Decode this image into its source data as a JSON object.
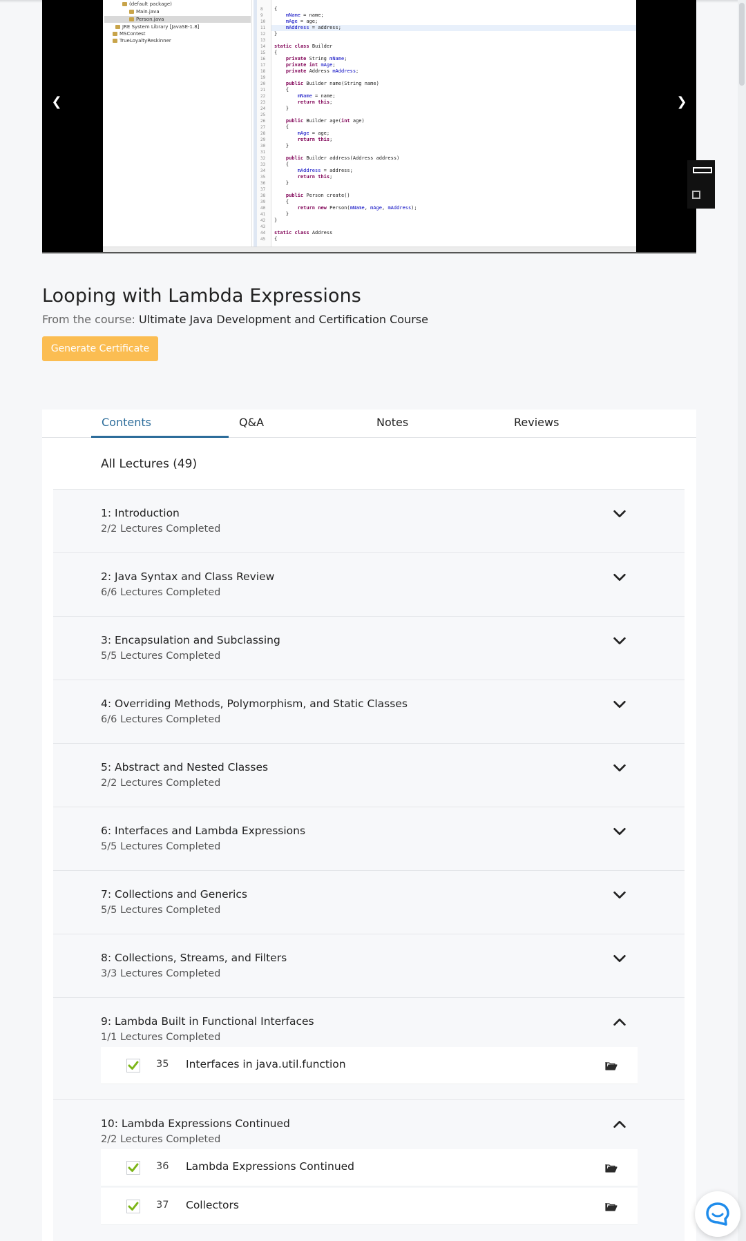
{
  "lesson": {
    "title": "Looping with Lambda Expressions",
    "course_prefix": "From the course:",
    "course_name": "Ultimate Java Development and Certification Course",
    "certificate_button": "Generate Certificate"
  },
  "player": {
    "prev_icon": "chevron-left-icon",
    "next_icon": "chevron-right-icon",
    "tree": [
      "(default package)",
      "Main.java",
      "Person.java",
      "JRE System Library [JavaSE-1.8]",
      "MSContest",
      "TrueLoyaltyReskinner"
    ],
    "code_lines": [
      "{",
      "    mName = name;",
      "    mAge = age;",
      "    mAddress = address;",
      "}",
      "",
      "static class Builder",
      "{",
      "    private String mName;",
      "    private int mAge;",
      "    private Address mAddress;",
      "",
      "    public Builder name(String name)",
      "    {",
      "        mName = name;",
      "        return this;",
      "    }",
      "",
      "    public Builder age(int age)",
      "    {",
      "        mAge = age;",
      "        return this;",
      "    }",
      "",
      "    public Builder address(Address address)",
      "    {",
      "        mAddress = address;",
      "        return this;",
      "    }",
      "",
      "    public Person create()",
      "    {",
      "        return new Person(mName, mAge, mAddress);",
      "    }",
      "}",
      "",
      "static class Address",
      "{"
    ]
  },
  "tabs": [
    {
      "label": "Contents",
      "active": true
    },
    {
      "label": "Q&A",
      "active": false
    },
    {
      "label": "Notes",
      "active": false
    },
    {
      "label": "Reviews",
      "active": false
    }
  ],
  "contents": {
    "all_lectures_label": "All Lectures (49)",
    "sections": [
      {
        "title": "1: Introduction",
        "progress": "2/2 Lectures Completed",
        "expanded": false
      },
      {
        "title": "2: Java Syntax and Class Review",
        "progress": "6/6 Lectures Completed",
        "expanded": false
      },
      {
        "title": "3: Encapsulation and Subclassing",
        "progress": "5/5 Lectures Completed",
        "expanded": false
      },
      {
        "title": "4: Overriding Methods, Polymorphism, and Static Classes",
        "progress": "6/6 Lectures Completed",
        "expanded": false
      },
      {
        "title": "5: Abstract and Nested Classes",
        "progress": "2/2 Lectures Completed",
        "expanded": false
      },
      {
        "title": "6: Interfaces and Lambda Expressions",
        "progress": "5/5 Lectures Completed",
        "expanded": false
      },
      {
        "title": "7: Collections and Generics",
        "progress": "5/5 Lectures Completed",
        "expanded": false
      },
      {
        "title": "8: Collections, Streams, and Filters",
        "progress": "3/3 Lectures Completed",
        "expanded": false
      },
      {
        "title": "9: Lambda Built in Functional Interfaces",
        "progress": "1/1 Lectures Completed",
        "expanded": true,
        "lectures": [
          {
            "number": "35",
            "title": "Interfaces in java.util.function",
            "completed": true
          }
        ]
      },
      {
        "title": "10: Lambda Expressions Continued",
        "progress": "2/2 Lectures Completed",
        "expanded": true,
        "lectures": [
          {
            "number": "36",
            "title": "Lambda Expressions Continued",
            "completed": true
          },
          {
            "number": "37",
            "title": "Collectors",
            "completed": true
          }
        ]
      }
    ]
  },
  "colors": {
    "accent": "#2c6c9a",
    "certificate_button": "#fbbd52",
    "check": "#7cb518",
    "chat": "#1f8ceb"
  },
  "chat": {
    "icon": "chat-bubble-icon"
  }
}
